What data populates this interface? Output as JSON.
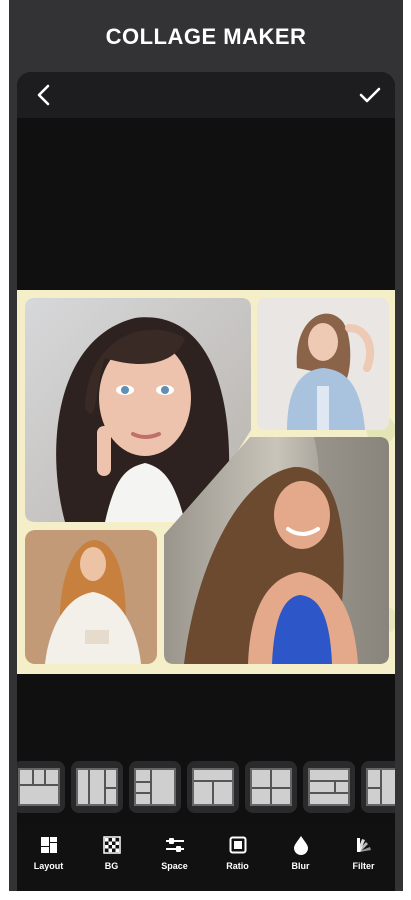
{
  "app": {
    "title": "COLLAGE MAKER"
  },
  "topbar": {
    "back_icon": "chevron-left-icon",
    "done_icon": "checkmark-icon"
  },
  "collage": {
    "background_color": "#f4efc9",
    "photos": [
      {
        "name": "photo-woman-freckles"
      },
      {
        "name": "photo-woman-denim-shirt"
      },
      {
        "name": "photo-woman-blue-top-tree"
      },
      {
        "name": "photo-woman-white-blouse"
      }
    ]
  },
  "layouts": [
    {
      "name": "layout-1"
    },
    {
      "name": "layout-2"
    },
    {
      "name": "layout-3"
    },
    {
      "name": "layout-4"
    },
    {
      "name": "layout-5"
    },
    {
      "name": "layout-6"
    },
    {
      "name": "layout-7"
    }
  ],
  "nav": {
    "items": [
      {
        "label": "Layout",
        "icon": "layout-grid-icon"
      },
      {
        "label": "BG",
        "icon": "checker-pattern-icon"
      },
      {
        "label": "Space",
        "icon": "sliders-icon"
      },
      {
        "label": "Ratio",
        "icon": "square-ratio-icon"
      },
      {
        "label": "Blur",
        "icon": "droplet-icon"
      },
      {
        "label": "Filter",
        "icon": "filter-fan-icon"
      }
    ]
  }
}
